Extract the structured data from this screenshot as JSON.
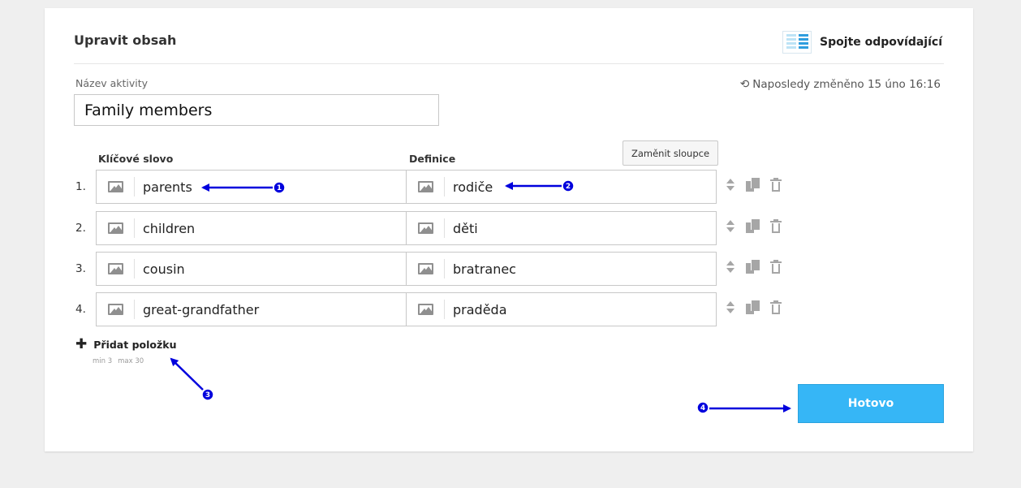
{
  "header": {
    "title": "Upravit obsah",
    "activity_type": "Spojte odpovídající",
    "activity_type_icon": "match-columns-icon"
  },
  "activity": {
    "name_label": "Název aktivity",
    "name_value": "Family members",
    "last_modified": "Naposledy změněno 15 úno 16:16"
  },
  "table": {
    "swap_button": "Zaměnit sloupce",
    "key_header": "Klíčové slovo",
    "def_header": "Definice",
    "rows": [
      {
        "num": "1.",
        "key": "parents",
        "def": "rodiče"
      },
      {
        "num": "2.",
        "key": "children",
        "def": "děti"
      },
      {
        "num": "3.",
        "key": "cousin",
        "def": "bratranec"
      },
      {
        "num": "4.",
        "key": "great-grandfather",
        "def": "praděda"
      }
    ]
  },
  "add": {
    "label": "Přidat položku",
    "min": "min 3",
    "max": "max 30"
  },
  "done_button": "Hotovo",
  "annotations": [
    "1",
    "2",
    "3",
    "4"
  ],
  "colors": {
    "accent": "#36b6f6",
    "annotation": "#0000dd",
    "background": "#efefef"
  }
}
